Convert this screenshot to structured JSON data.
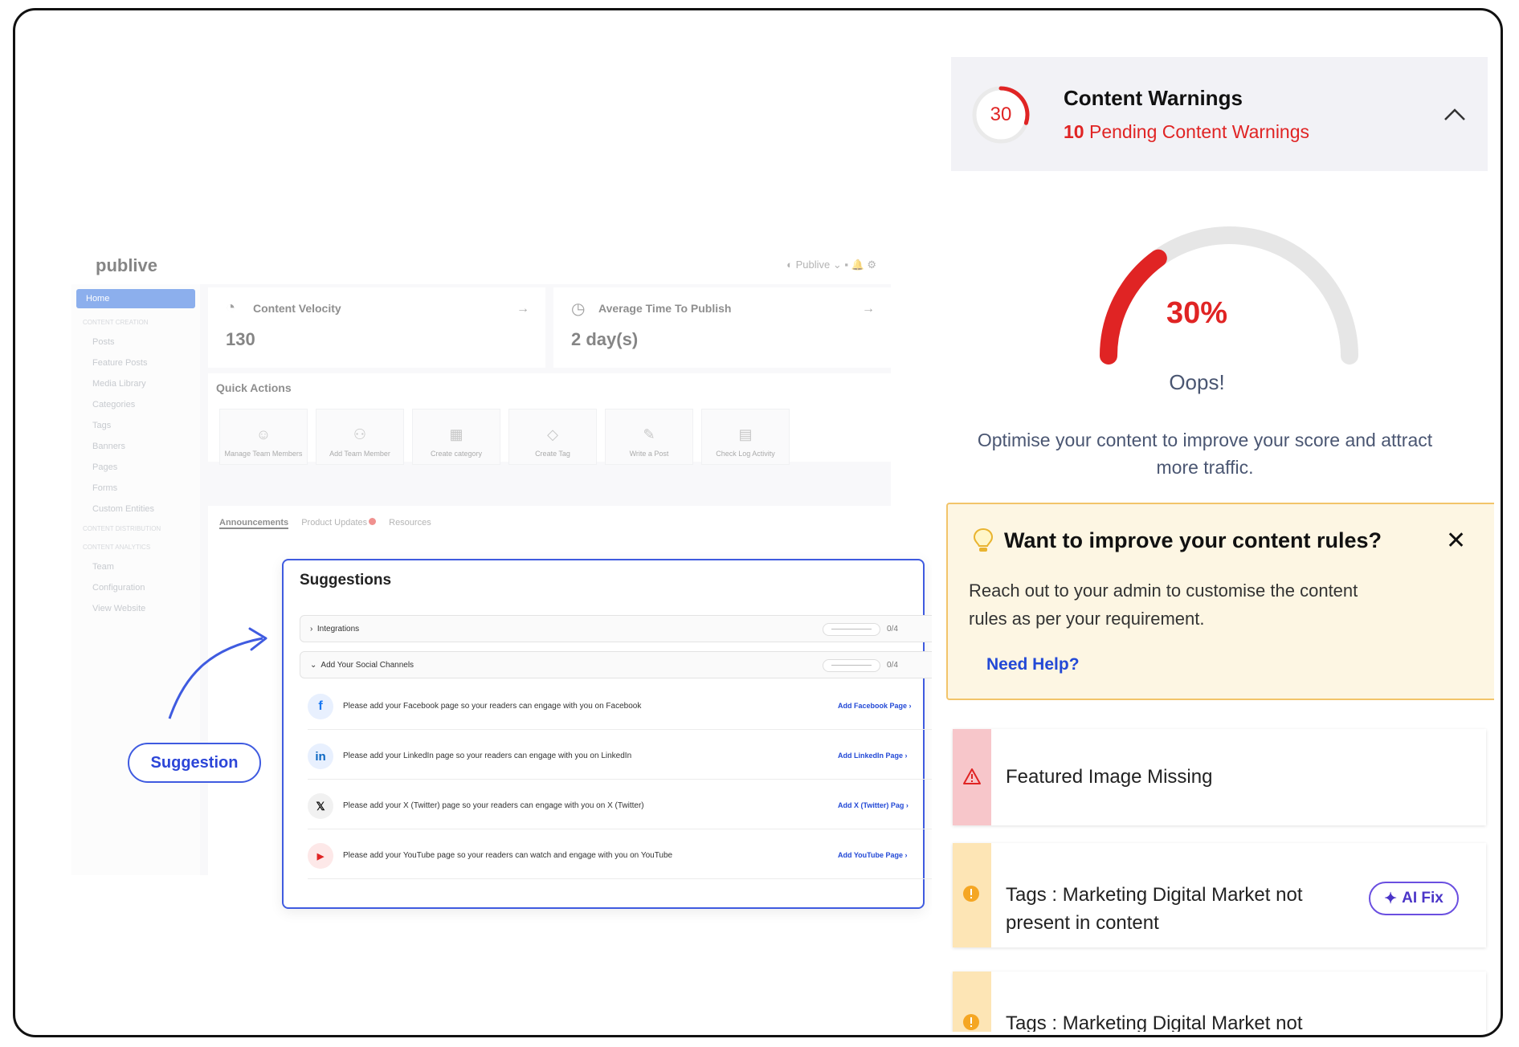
{
  "dashboard": {
    "logo": "publive",
    "brand_menu": "Publive",
    "sidebar": [
      {
        "label": "Home",
        "kind": "active"
      },
      {
        "label": "CONTENT CREATION",
        "kind": "section"
      },
      {
        "label": "Posts",
        "kind": "item"
      },
      {
        "label": "Feature Posts",
        "kind": "item"
      },
      {
        "label": "Media Library",
        "kind": "item"
      },
      {
        "label": "Categories",
        "kind": "item"
      },
      {
        "label": "Tags",
        "kind": "item"
      },
      {
        "label": "Banners",
        "kind": "item"
      },
      {
        "label": "Pages",
        "kind": "item"
      },
      {
        "label": "Forms",
        "kind": "item"
      },
      {
        "label": "Custom Entities",
        "kind": "item"
      },
      {
        "label": "CONTENT DISTRIBUTION",
        "kind": "section"
      },
      {
        "label": "CONTENT ANALYTICS",
        "kind": "section"
      },
      {
        "label": "Team",
        "kind": "item"
      },
      {
        "label": "Configuration",
        "kind": "item"
      },
      {
        "label": "View Website",
        "kind": "item"
      }
    ],
    "kpi_velocity": {
      "title": "Content Velocity",
      "value": "130"
    },
    "kpi_publish": {
      "title": "Average Time To Publish",
      "value": "2 day(s)"
    },
    "quick_actions_title": "Quick Actions",
    "quick_actions": [
      {
        "label": "Manage Team Members",
        "icon": "team-icon"
      },
      {
        "label": "Add Team Member",
        "icon": "add-user-icon"
      },
      {
        "label": "Create category",
        "icon": "category-icon"
      },
      {
        "label": "Create Tag",
        "icon": "tag-icon"
      },
      {
        "label": "Write a Post",
        "icon": "edit-icon"
      },
      {
        "label": "Check Log Activity",
        "icon": "log-icon"
      }
    ],
    "tabs": [
      "Announcements",
      "Product Updates",
      "Resources"
    ]
  },
  "suggestions": {
    "title": "Suggestions",
    "groups": [
      {
        "label": "Integrations",
        "count": "0/4"
      },
      {
        "label": "Add Your Social Channels",
        "count": "0/4"
      }
    ],
    "items": [
      {
        "icon": "facebook-icon",
        "glyph": "f",
        "text": "Please add your Facebook page so your readers can engage with you on Facebook",
        "action": "Add Facebook Page"
      },
      {
        "icon": "linkedin-icon",
        "glyph": "in",
        "text": "Please add your LinkedIn page so your readers can engage with you on LinkedIn",
        "action": "Add LinkedIn Page"
      },
      {
        "icon": "x-twitter-icon",
        "glyph": "𝕏",
        "text": "Please add your X (Twitter) page so your readers can engage with you on X (Twitter)",
        "action": "Add X (Twitter) Pag"
      },
      {
        "icon": "youtube-icon",
        "glyph": "▶",
        "text": "Please add your YouTube page so your readers can watch and engage with you on YouTube",
        "action": "Add YouTube Page"
      }
    ],
    "callout_label": "Suggestion"
  },
  "content_warnings": {
    "score": "30",
    "score_fraction": 0.3,
    "title": "Content Warnings",
    "pending_count": "10",
    "pending_text": "Pending Content Warnings",
    "gauge_percent": "30%",
    "status": "Oops!",
    "message": "Optimise your content to improve your score and attract more traffic.",
    "colors": {
      "accent": "#e02424",
      "tip_bg": "#fdf6e3",
      "tip_border": "#f2c46a"
    }
  },
  "tip": {
    "title": "Want to improve your content rules?",
    "body": "Reach out to your admin to customise the content rules as per your requirement.",
    "help_link": "Need Help?"
  },
  "warnings": [
    {
      "text": "Featured Image Missing",
      "level": "error",
      "icon": "warning-triangle-icon"
    },
    {
      "text": "Tags : Marketing Digital Market not present in content",
      "level": "warning",
      "icon": "alert-circle-icon",
      "action": "AI Fix"
    },
    {
      "text": "Tags : Marketing Digital Market not",
      "level": "warning",
      "icon": "alert-circle-icon"
    }
  ]
}
